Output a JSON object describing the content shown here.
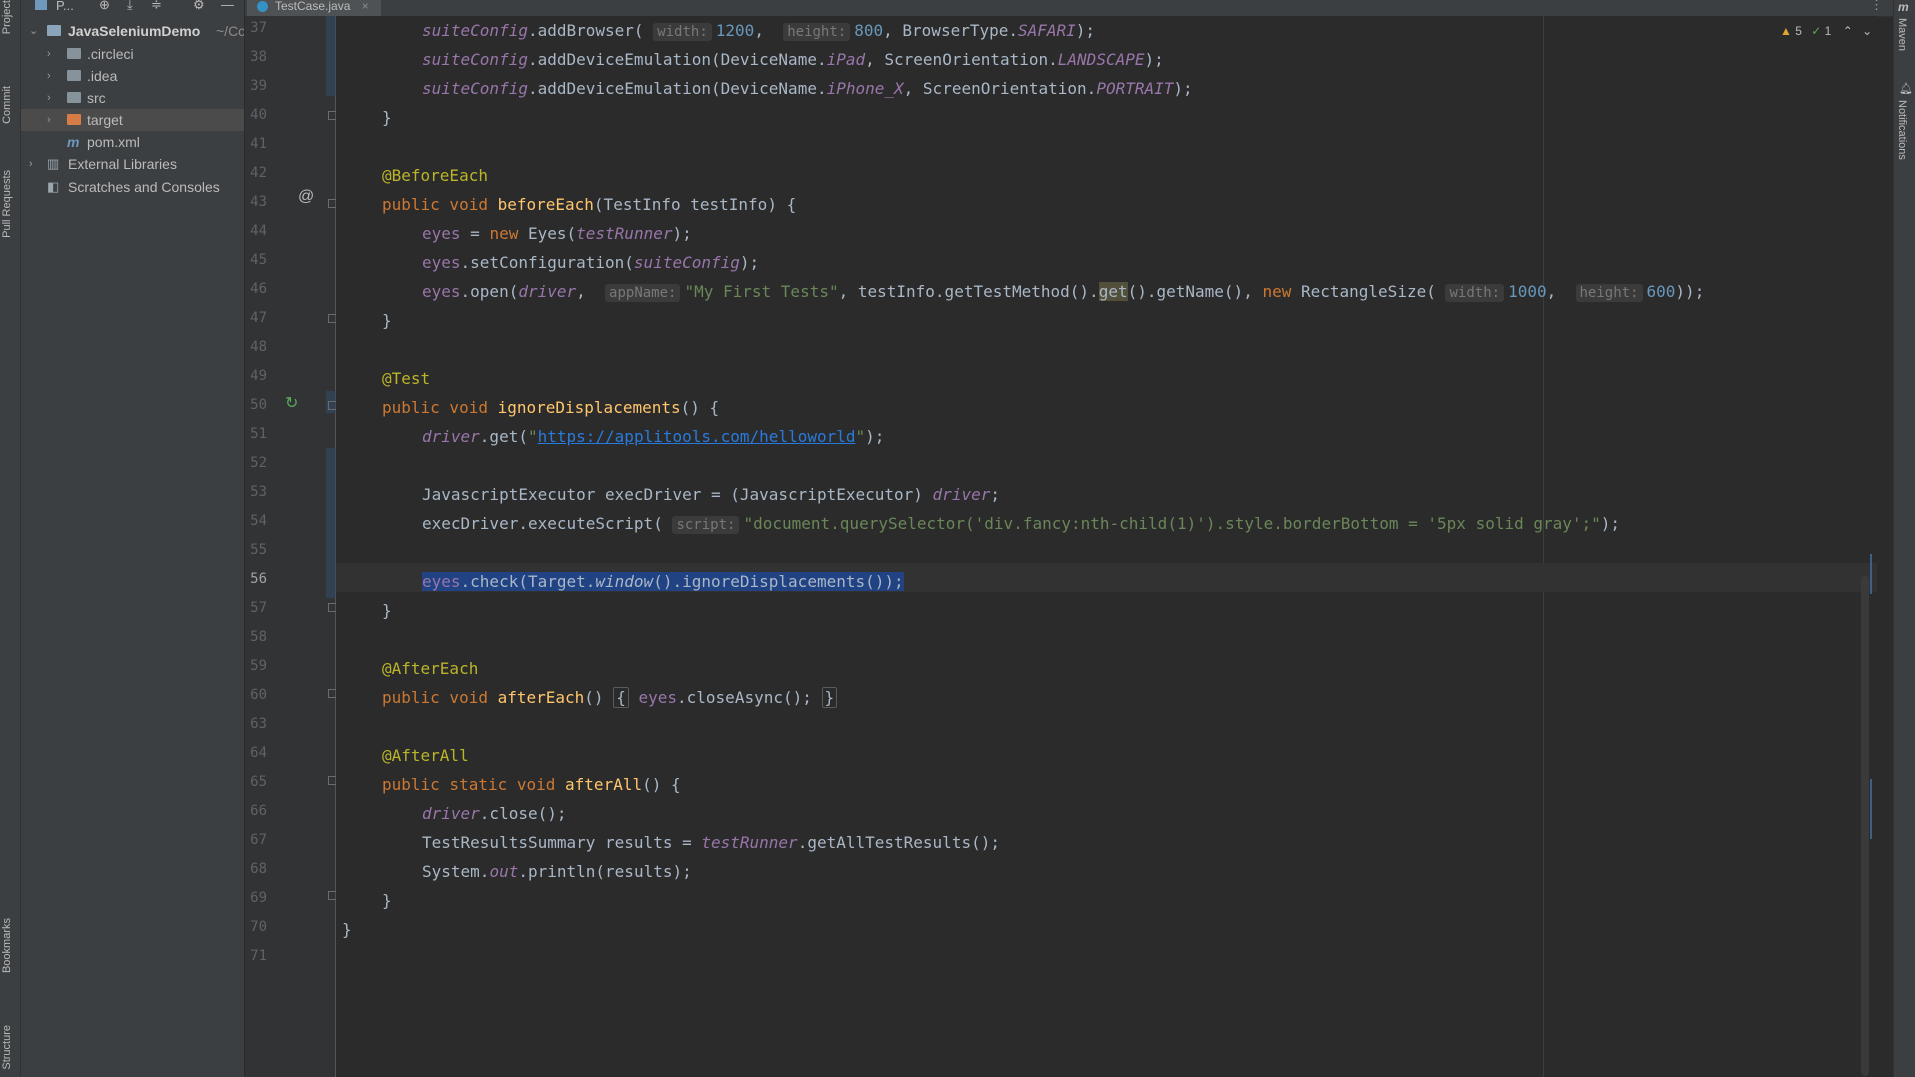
{
  "colors": {
    "keyword": "#cc7832",
    "function": "#ffc66d",
    "annotation": "#bbb529",
    "string": "#6a8759",
    "number": "#6897bb",
    "field": "#9876aa",
    "selection": "#214283"
  },
  "left_strip": {
    "project": "Project",
    "commit": "Commit",
    "pull_requests": "Pull Requests",
    "bookmarks": "Bookmarks",
    "structure": "Structure"
  },
  "right_strip": {
    "maven": "Maven",
    "notifications": "Notifications"
  },
  "project_pane": {
    "title": "P...",
    "toolbar_icons": [
      "locate-icon",
      "expand-all-icon",
      "collapse-all-icon",
      "gear-icon",
      "minimize-icon"
    ],
    "tree": [
      {
        "label": "JavaSeleniumDemo",
        "suffix": "~/Cc",
        "expanded": true
      },
      {
        "label": ".circleci"
      },
      {
        "label": ".idea"
      },
      {
        "label": "src"
      },
      {
        "label": "target",
        "selected": true
      },
      {
        "label": "pom.xml",
        "icon": "maven-icon"
      },
      {
        "label": "External Libraries"
      },
      {
        "label": "Scratches and Consoles"
      }
    ]
  },
  "tab": {
    "label": "TestCase.java",
    "close": "×"
  },
  "status": {
    "warnings": "5",
    "ok": "1"
  },
  "editor": {
    "current_line": "56",
    "line_numbers": [
      "37",
      "38",
      "39",
      "40",
      "41",
      "42",
      "43",
      "44",
      "45",
      "46",
      "47",
      "48",
      "49",
      "50",
      "51",
      "52",
      "53",
      "54",
      "55",
      "56",
      "57",
      "58",
      "59",
      "60",
      "63",
      "64",
      "65",
      "66",
      "67",
      "68",
      "69",
      "70",
      "71"
    ],
    "url": "https://applitools.com/helloworld",
    "script_string": "\"document.querySelector('div.fancy:nth-child(1)').style.borderBottom = '5px solid gray';\"",
    "app_name": "\"My First Tests\""
  }
}
